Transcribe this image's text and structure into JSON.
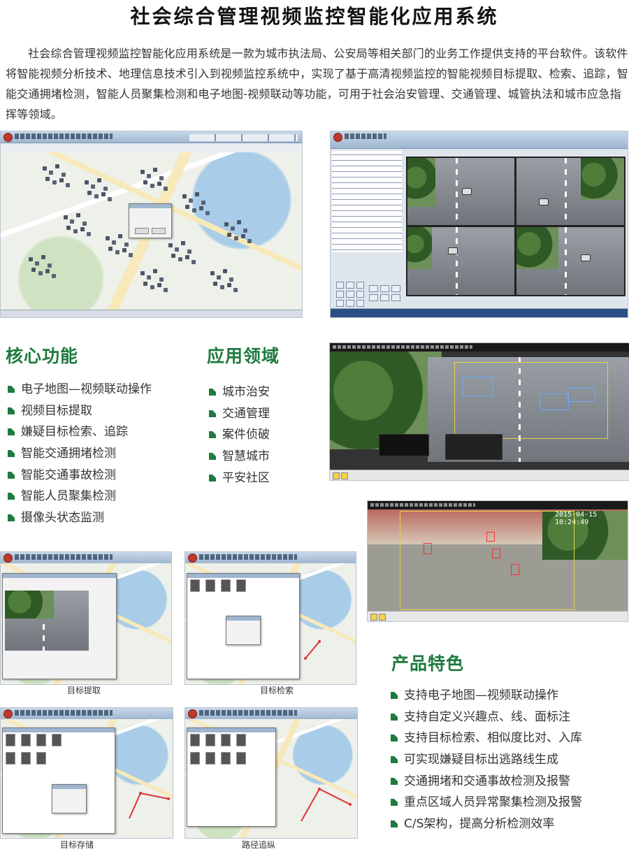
{
  "title": "社会综合管理视频监控智能化应用系统",
  "intro": "社会综合管理视频监控智能化应用系统是一款为城市执法局、公安局等相关部门的业务工作提供支持的平台软件。该软件将智能视频分析技术、地理信息技术引入到视频监控系统中，实现了基于高清视频监控的智能视频目标提取、检索、追踪，智能交通拥堵检测，智能人员聚集检测和电子地图-视频联动等功能，可用于社会治安管理、交通管理、城管执法和城市应急指挥等领域。",
  "core": {
    "heading": "核心功能",
    "items": [
      "电子地图—视频联动操作",
      "视频目标提取",
      "嫌疑目标检索、追踪",
      "智能交通拥堵检测",
      "智能交通事故检测",
      "智能人员聚集检测",
      "摄像头状态监测"
    ]
  },
  "apps": {
    "heading": "应用领域",
    "items": [
      "城市治安",
      "交通管理",
      "案件侦破",
      "智慧城市",
      "平安社区"
    ]
  },
  "features": {
    "heading": "产品特色",
    "items": [
      "支持电子地图—视频联动操作",
      "支持自定义兴趣点、线、面标注",
      "支持目标检索、相似度比对、入库",
      "可实现嫌疑目标出逃路线生成",
      "交通拥堵和交通事故检测及报警",
      "重点区域人员异常聚集检测及报警",
      "C/S架构，提高分析检测效率"
    ]
  },
  "screens": {
    "video_overlay": "2015-04-15 10:24:49",
    "captions": [
      "目标提取",
      "目标检索",
      "目标存储",
      "路径追纵"
    ]
  },
  "colors": {
    "accent": "#1e7a3e",
    "bullet": "#1e7a3e",
    "window_chrome": "#9fb6d0"
  }
}
